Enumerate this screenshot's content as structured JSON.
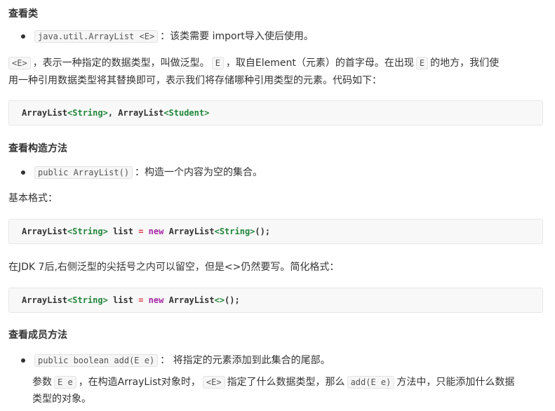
{
  "section_view_class": {
    "heading": "查看类",
    "bullet_code": "java.util.ArrayList <E>",
    "bullet_text": "：该类需要 import导入使后使用。",
    "para_line1": {
      "code_e1": "<E>",
      "t1": "，表示一种指定的数据类型，叫做泛型。",
      "code_e2": "E",
      "t2": "，取自Element（元素）的首字母。在出现",
      "code_e3": "E",
      "t3": "的地方，我们使"
    },
    "para_line2": "用一种引用数据类型将其替换即可，表示我们将存储哪种引用类型的元素。代码如下：",
    "code": {
      "p1": "ArrayList",
      "p2": "<String>",
      "p3": ", ",
      "p4": "ArrayList",
      "p5": "<Student>"
    }
  },
  "section_constructor": {
    "heading": "查看构造方法",
    "bullet_code": "public ArrayList()",
    "bullet_text": "：构造一个内容为空的集合。",
    "format_label": "基本格式：",
    "code1": {
      "p1": "ArrayList",
      "p2": "<String>",
      "p3": " list ",
      "p4": "=",
      "p5": " ",
      "p6": "new",
      "p7": " ArrayList",
      "p8": "<String>",
      "p9": "();"
    },
    "jdk_note": "在JDK 7后,右侧泛型的尖括号之内可以留空，但是<>仍然要写。简化格式：",
    "code2": {
      "p1": "ArrayList",
      "p2": "<String>",
      "p3": " list ",
      "p4": "=",
      "p5": " ",
      "p6": "new",
      "p7": " ArrayList",
      "p8": "<>",
      "p9": "();"
    }
  },
  "section_members": {
    "heading": "查看成员方法",
    "bullet_code": "public boolean add(E e)",
    "bullet_text": "： 将指定的元素添加到此集合的尾部。",
    "param_line1": {
      "t1": "参数",
      "code1": "E e",
      "t2": "，在构造ArrayList对象时，",
      "code2": "<E>",
      "t3": "指定了什么数据类型，那么",
      "code3": "add(E e)",
      "t4": "方法中，只能添加什么数据"
    },
    "param_line2": "类型的对象。"
  },
  "colors": {
    "generic_type": "#22863a",
    "keyword": "#a626a4",
    "operator": "#d73a49"
  }
}
